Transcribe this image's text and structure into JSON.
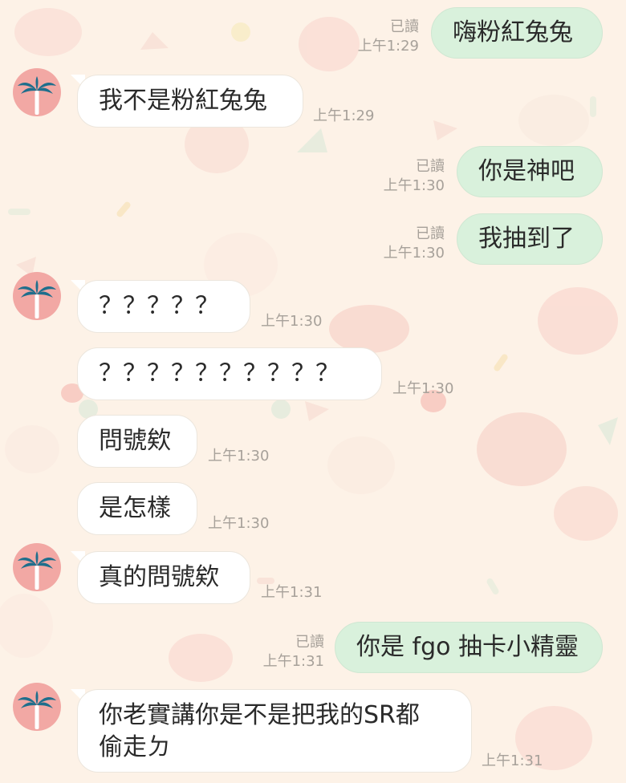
{
  "theme": {
    "background": "#fdf2e7",
    "incoming_bubble": "#ffffff",
    "outgoing_bubble": "#d9f1dc",
    "avatar_bg": "#f2a8a4",
    "avatar_icon": "palm-tree-icon"
  },
  "messages": [
    {
      "id": "m1",
      "from": "me",
      "text": "嗨粉紅兔兔",
      "status": "已讀",
      "time": "上午1:29"
    },
    {
      "id": "m2",
      "from": "friend",
      "text": "我不是粉紅兔兔",
      "time": "上午1:29"
    },
    {
      "id": "m3",
      "from": "me",
      "text": "你是神吧",
      "status": "已讀",
      "time": "上午1:30"
    },
    {
      "id": "m4",
      "from": "me",
      "text": "我抽到了",
      "status": "已讀",
      "time": "上午1:30"
    },
    {
      "id": "m5",
      "from": "friend",
      "text": "？？？？？",
      "time": "上午1:30"
    },
    {
      "id": "m6",
      "from": "friend",
      "text": "？？？？？？？？？？",
      "time": "上午1:30"
    },
    {
      "id": "m7",
      "from": "friend",
      "text": "問號欸",
      "time": "上午1:30"
    },
    {
      "id": "m8",
      "from": "friend",
      "text": "是怎樣",
      "time": "上午1:30"
    },
    {
      "id": "m9",
      "from": "friend",
      "text": "真的問號欸",
      "time": "上午1:31"
    },
    {
      "id": "m10",
      "from": "me",
      "text": "你是 fgo 抽卡小精靈",
      "status": "已讀",
      "time": "上午1:31"
    },
    {
      "id": "m11",
      "from": "friend",
      "text_lines": [
        "你老實講你是不是把我的SR都",
        "偷走ㄉ"
      ],
      "time": "上午1:31"
    }
  ]
}
